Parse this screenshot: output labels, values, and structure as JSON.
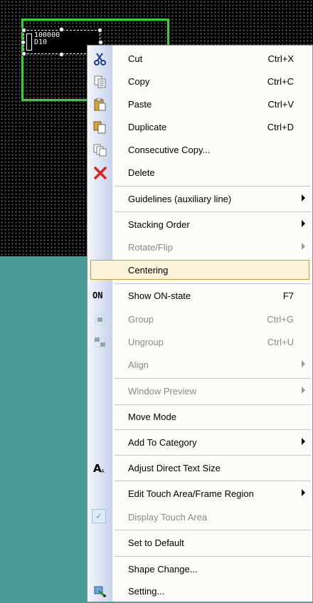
{
  "canvas": {
    "object_text": "100000\nD10"
  },
  "menu": {
    "items": [
      {
        "label": "Cut",
        "shortcut": "Ctrl+X"
      },
      {
        "label": "Copy",
        "shortcut": "Ctrl+C"
      },
      {
        "label": "Paste",
        "shortcut": "Ctrl+V"
      },
      {
        "label": "Duplicate",
        "shortcut": "Ctrl+D"
      },
      {
        "label": "Consecutive Copy...",
        "shortcut": ""
      },
      {
        "label": "Delete",
        "shortcut": ""
      },
      {
        "label": "Guidelines (auxiliary line)",
        "shortcut": ""
      },
      {
        "label": "Stacking Order",
        "shortcut": ""
      },
      {
        "label": "Rotate/Flip",
        "shortcut": ""
      },
      {
        "label": "Centering",
        "shortcut": ""
      },
      {
        "label": "Show ON-state",
        "shortcut": "F7",
        "icon_text": "ON"
      },
      {
        "label": "Group",
        "shortcut": "Ctrl+G"
      },
      {
        "label": "Ungroup",
        "shortcut": "Ctrl+U"
      },
      {
        "label": "Align",
        "shortcut": ""
      },
      {
        "label": "Window Preview",
        "shortcut": ""
      },
      {
        "label": "Move Mode",
        "shortcut": ""
      },
      {
        "label": "Add To Category",
        "shortcut": ""
      },
      {
        "label": "Adjust Direct Text Size",
        "shortcut": ""
      },
      {
        "label": "Edit Touch Area/Frame Region",
        "shortcut": ""
      },
      {
        "label": "Display Touch Area",
        "shortcut": ""
      },
      {
        "label": "Set to Default",
        "shortcut": ""
      },
      {
        "label": "Shape Change...",
        "shortcut": ""
      },
      {
        "label": "Setting...",
        "shortcut": ""
      }
    ]
  },
  "colors": {
    "canvas_bg": "#000000",
    "frame_green": "#2fd62f",
    "teal_bg": "#4a9a98",
    "highlight_bg": "#fcf3d8",
    "highlight_border": "#c89b3c"
  }
}
